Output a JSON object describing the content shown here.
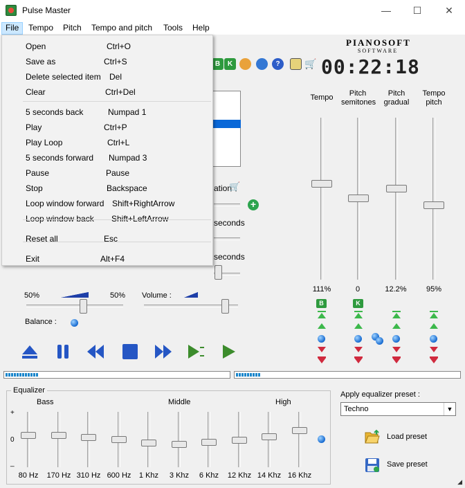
{
  "window": {
    "title": "Pulse Master",
    "minimize": "—",
    "maximize": "☐",
    "close": "✕"
  },
  "menubar": [
    "File",
    "Tempo",
    "Pitch",
    "Tempo and pitch",
    "Tools",
    "Help"
  ],
  "file_menu": [
    {
      "label": "Open",
      "shortcut": "Ctrl+O"
    },
    {
      "label": "Save as",
      "shortcut": "Ctrl+S"
    },
    {
      "label": "Delete selected item",
      "shortcut": "Del"
    },
    {
      "label": "Clear",
      "shortcut": "Ctrl+Del"
    },
    {
      "label": "5 seconds back",
      "shortcut": "Numpad 1"
    },
    {
      "label": "Play",
      "shortcut": "Ctrl+P"
    },
    {
      "label": "Play Loop",
      "shortcut": "Ctrl+L"
    },
    {
      "label": "5 seconds forward",
      "shortcut": "Numpad 3"
    },
    {
      "label": "Pause",
      "shortcut": "Pause"
    },
    {
      "label": "Stop",
      "shortcut": "Backspace"
    },
    {
      "label": "Loop window forward",
      "shortcut": "Shift+RightArrow"
    },
    {
      "label": "Loop window back",
      "shortcut": "Shift+LeftArrow"
    },
    {
      "label": "Reset all",
      "shortcut": "Esc"
    },
    {
      "label": "Exit",
      "shortcut": "Alt+F4"
    }
  ],
  "brand": {
    "name": "PIANOSOFT",
    "sub": "SOFTWARE"
  },
  "clock": "00:22:18",
  "toolbar_icons": [
    "b-icon",
    "k-icon",
    "users-icon",
    "globe-icon",
    "help-icon",
    "notepad-icon",
    "cart-icon"
  ],
  "partial_text": {
    "ation": "ation",
    "seconds_1": "seconds",
    "seconds_2": "seconds"
  },
  "balance": {
    "left": "50%",
    "right": "50%",
    "label": "Balance :"
  },
  "volume": {
    "label": "Volume :"
  },
  "columns": [
    {
      "label": "Tempo",
      "value": "111%"
    },
    {
      "label": "Pitch semitones",
      "value": "0"
    },
    {
      "label": "Pitch gradual",
      "value": "12.2%"
    },
    {
      "label": "Tempo pitch",
      "value": "95%"
    }
  ],
  "column_buttons": {
    "b": "B",
    "k": "K"
  },
  "equalizer": {
    "title": "Equalizer",
    "groups": [
      "Bass",
      "Middle",
      "High"
    ],
    "axis": [
      "+",
      "0",
      "_"
    ],
    "bands": [
      {
        "freq": "80 Hz",
        "level": 0.42
      },
      {
        "freq": "170 Hz",
        "level": 0.42
      },
      {
        "freq": "310 Hz",
        "level": 0.45
      },
      {
        "freq": "600 Hz",
        "level": 0.5
      },
      {
        "freq": "1 Khz",
        "level": 0.57
      },
      {
        "freq": "3 Khz",
        "level": 0.6
      },
      {
        "freq": "6 Khz",
        "level": 0.55
      },
      {
        "freq": "12 Khz",
        "level": 0.51
      },
      {
        "freq": "14 Khz",
        "level": 0.44
      },
      {
        "freq": "16 Khz",
        "level": 0.32
      }
    ]
  },
  "preset": {
    "label": "Apply equalizer preset :",
    "selected": "Techno",
    "load": "Load preset",
    "save": "Save preset"
  }
}
